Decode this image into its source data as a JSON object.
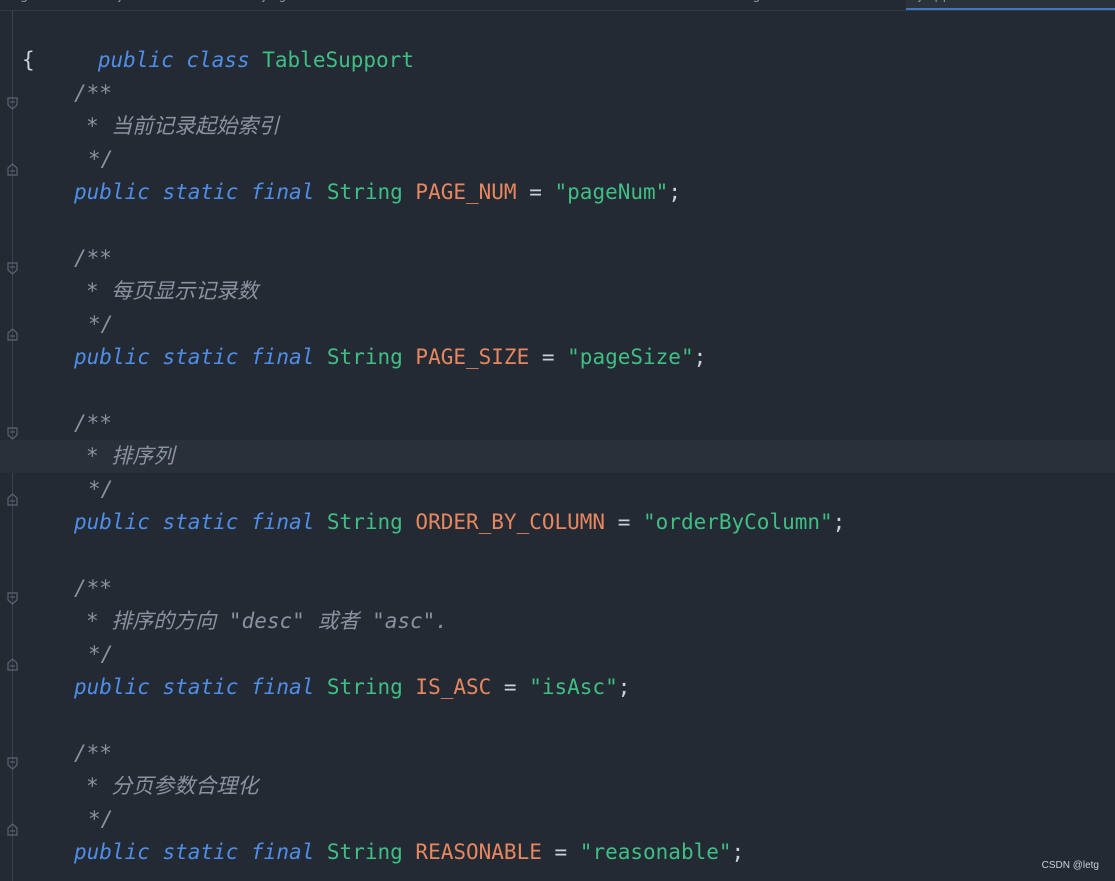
{
  "editor": {
    "tabs": [
      {
        "label": "g..."
      },
      {
        "label": "..j..."
      },
      {
        "label": "...j...g..."
      },
      {
        "label": "......"
      },
      {
        "label": "...g..."
      },
      {
        "label": "...j...pp..."
      }
    ],
    "class_decl": {
      "keyword1": "public",
      "keyword2": "class",
      "name": "TableSupport"
    },
    "open_brace": "{",
    "fields": [
      {
        "comment_open": "/**",
        "comment_text": "* 当前记录起始索引",
        "comment_close": "*/",
        "modifiers": [
          "public",
          "static",
          "final"
        ],
        "type": "String",
        "name": "PAGE_NUM",
        "assign": " = ",
        "value": "\"pageNum\"",
        "semi": ";"
      },
      {
        "comment_open": "/**",
        "comment_text": "* 每页显示记录数",
        "comment_close": "*/",
        "modifiers": [
          "public",
          "static",
          "final"
        ],
        "type": "String",
        "name": "PAGE_SIZE",
        "assign": " = ",
        "value": "\"pageSize\"",
        "semi": ";"
      },
      {
        "comment_open": "/**",
        "comment_text": "* 排序列",
        "comment_close": "*/",
        "modifiers": [
          "public",
          "static",
          "final"
        ],
        "type": "String",
        "name": "ORDER_BY_COLUMN",
        "assign": " = ",
        "value": "\"orderByColumn\"",
        "semi": ";"
      },
      {
        "comment_open": "/**",
        "comment_text": "* 排序的方向 \"desc\" 或者 \"asc\".",
        "comment_close": "*/",
        "modifiers": [
          "public",
          "static",
          "final"
        ],
        "type": "String",
        "name": "IS_ASC",
        "assign": " = ",
        "value": "\"isAsc\"",
        "semi": ";"
      },
      {
        "comment_open": "/**",
        "comment_text": "* 分页参数合理化",
        "comment_close": "*/",
        "modifiers": [
          "public",
          "static",
          "final"
        ],
        "type": "String",
        "name": "REASONABLE",
        "assign": " = ",
        "value": "\"reasonable\"",
        "semi": ";"
      }
    ]
  },
  "watermark": "CSDN @letg",
  "colors": {
    "background": "#232a33",
    "keyword": "#4f8ee8",
    "type": "#3fbf84",
    "constant": "#e8875f",
    "string": "#3fbf84",
    "comment": "#8a939e",
    "plain": "#c9d1d9",
    "current_line": "#283039"
  },
  "icons": [
    "fold-start-icon",
    "fold-end-icon"
  ]
}
